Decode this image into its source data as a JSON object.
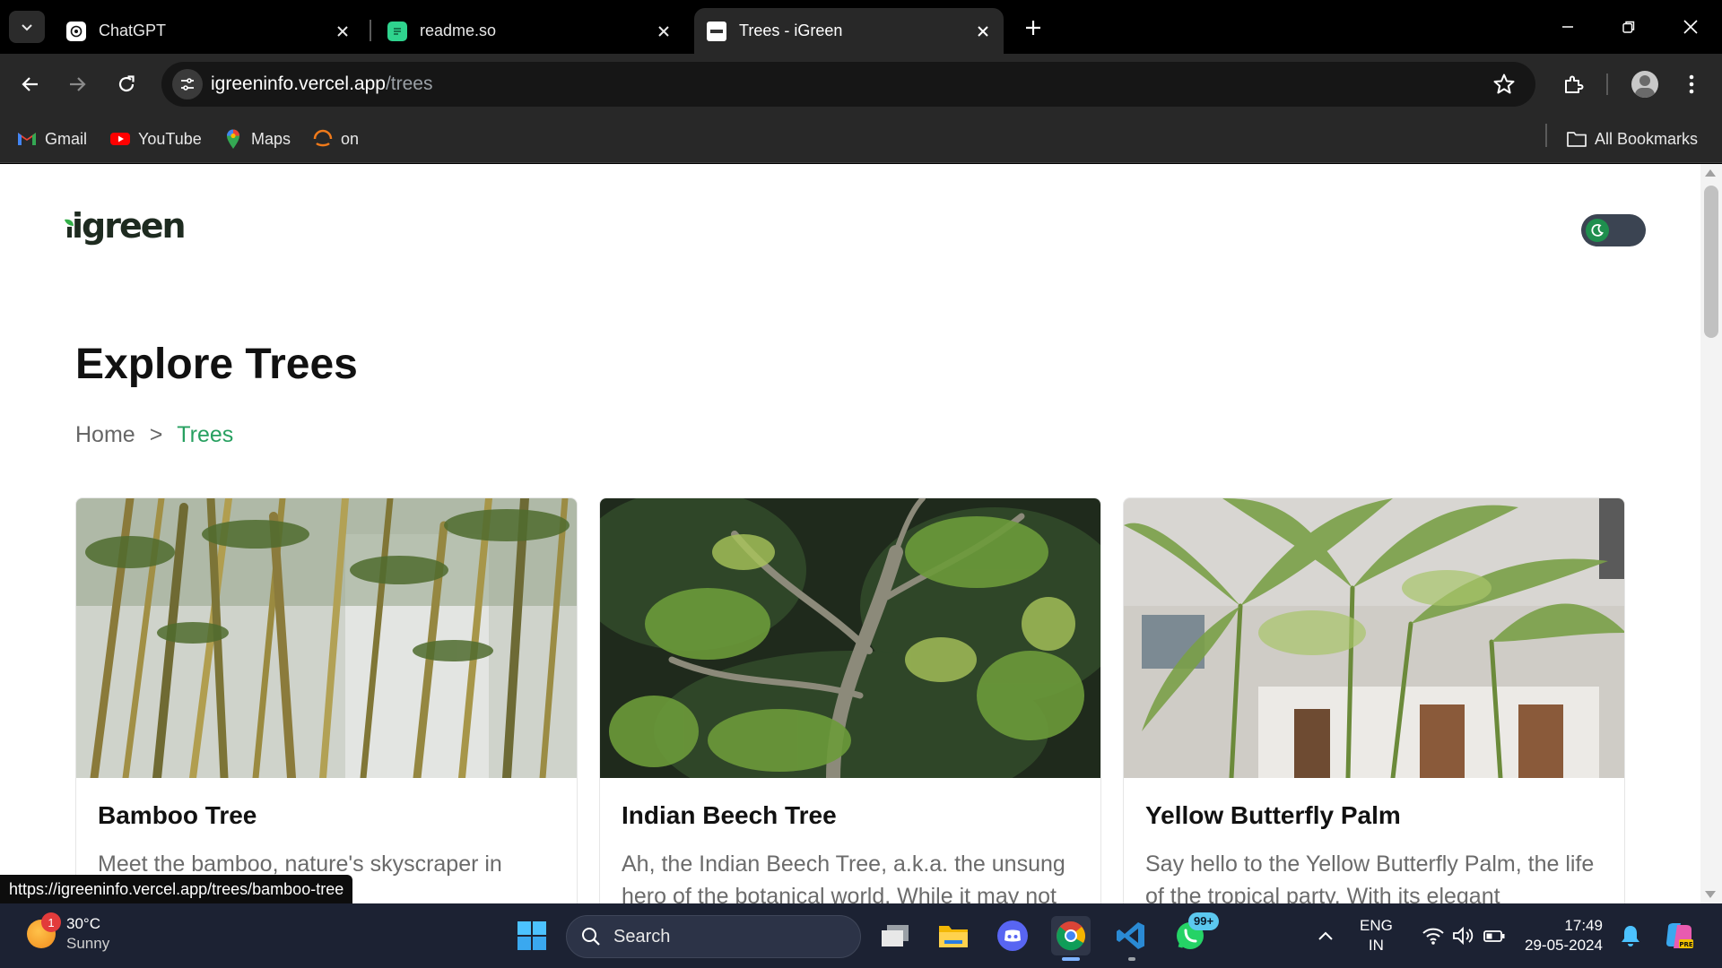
{
  "browser": {
    "tabs": [
      {
        "title": "ChatGPT",
        "active": false
      },
      {
        "title": "readme.so",
        "active": false
      },
      {
        "title": "Trees - iGreen",
        "active": true
      }
    ],
    "url_host": "igreeninfo.vercel.app",
    "url_path": "/trees",
    "bookmarks": [
      "Gmail",
      "YouTube",
      "Maps",
      "on"
    ],
    "all_bookmarks": "All Bookmarks"
  },
  "page": {
    "logo_text": "igreen",
    "title": "Explore Trees",
    "breadcrumb": {
      "home": "Home",
      "separator": ">",
      "current": "Trees"
    },
    "cards": [
      {
        "title": "Bamboo Tree",
        "description": "Meet the bamboo, nature's skyscraper in ...itha knack for"
      },
      {
        "title": "Indian Beech Tree",
        "description": "Ah, the Indian Beech Tree, a.k.a. the unsung hero of the botanical world. While it may not"
      },
      {
        "title": "Yellow Butterfly Palm",
        "description": "Say hello to the Yellow Butterfly Palm, the life of the tropical party. With its elegant"
      }
    ],
    "status_link": "https://igreeninfo.vercel.app/trees/bamboo-tree",
    "colors": {
      "accent": "#27a060",
      "logo_leaf": "#35b04a"
    }
  },
  "taskbar": {
    "weather": {
      "temp": "30°C",
      "condition": "Sunny",
      "badge": "1"
    },
    "search_placeholder": "Search",
    "whatsapp_badge": "99+",
    "language": {
      "line1": "ENG",
      "line2": "IN"
    },
    "time": "17:49",
    "date": "29-05-2024"
  }
}
